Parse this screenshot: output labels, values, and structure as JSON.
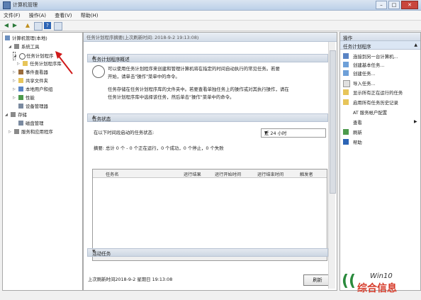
{
  "window": {
    "title": "计算机管理"
  },
  "menu": [
    "文件(F)",
    "操作(A)",
    "查看(V)",
    "帮助(H)"
  ],
  "tree": {
    "root": "计算机管理(本地)",
    "items": [
      {
        "label": "系统工具"
      },
      {
        "label": "任务计划程序"
      },
      {
        "label": "任务计划程序库"
      },
      {
        "label": "事件查看器"
      },
      {
        "label": "共享文件夹"
      },
      {
        "label": "本地用户和组"
      },
      {
        "label": "性能"
      },
      {
        "label": "设备管理器"
      },
      {
        "label": "存储"
      },
      {
        "label": "磁盘管理"
      },
      {
        "label": "服务和应用程序"
      }
    ]
  },
  "center": {
    "header": "任务计划程序摘要(上次刷新时间: 2018-9-2 19:13:08)",
    "overview_title": "任务计划程序概述",
    "overview_p1a": "可以使用任务计划程序来创建和管理计算机将在指定的时间自动执行的常见任务。若要",
    "overview_p1b": "开始，请单击\"操作\"菜单中的命令。",
    "overview_p2a": "任务存储在任务计划程序库的文件夹中。若要查看单独任务上的操作或对其执行操作，请在",
    "overview_p2b": "任务计划程序库中选择该任务，然后单击\"操作\"菜单中的命令。",
    "status_title": "任务状态",
    "status_label": "在以下时间段启动的任务状态:",
    "period": "近 24 小时",
    "summary": "摘要: 总计 0 个 - 0 个正在运行，0 个成功，0 个停止，0 个失败",
    "columns": [
      "任务名",
      "运行结果",
      "运行开始时间",
      "运行结束时间",
      "触发者"
    ],
    "active_title": "活动任务",
    "last_refresh": "上次刷新时间2018-9-2 星期日 19:13:08",
    "refresh_button": "刷新"
  },
  "actions": {
    "title": "操作",
    "sub_title": "任务计划程序",
    "items": [
      {
        "label": "连接到另一台计算机...",
        "icon": "computer-icon"
      },
      {
        "label": "创建基本任务...",
        "icon": "create-basic-task-icon"
      },
      {
        "label": "创建任务...",
        "icon": "create-task-icon"
      },
      {
        "label": "导入任务...",
        "icon": "import-icon"
      },
      {
        "label": "显示所有正在运行的任务",
        "icon": "running-tasks-icon"
      },
      {
        "label": "启用所有任务历史记录",
        "icon": "history-icon"
      },
      {
        "label": "AT 服务帐户配置",
        "icon": "none"
      },
      {
        "label": "查看",
        "icon": "view-icon"
      },
      {
        "label": "刷新",
        "icon": "refresh-icon"
      },
      {
        "label": "帮助",
        "icon": "help-icon"
      }
    ]
  },
  "watermark": {
    "brand": "综合信息",
    "os": "Win10"
  }
}
